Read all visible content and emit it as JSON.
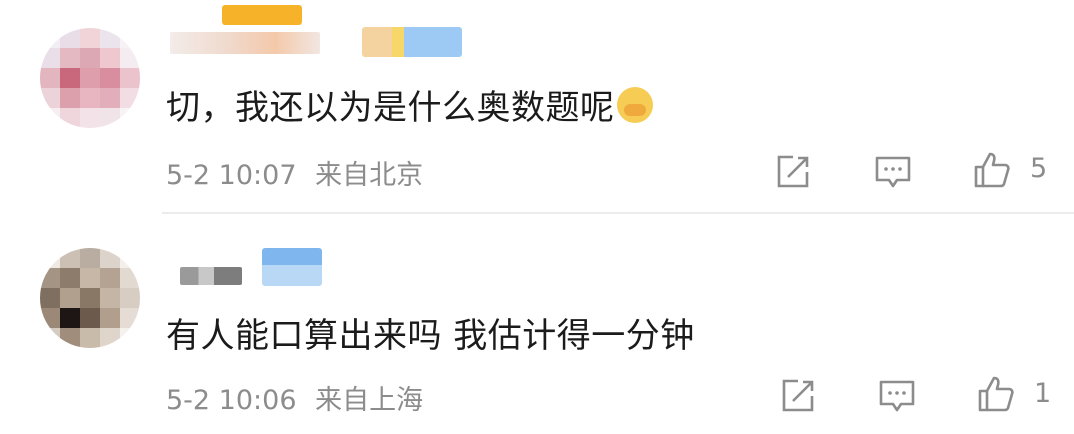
{
  "comments": [
    {
      "text": "切，我还以为是什么奥数题呢",
      "emoji_icon": "angry-face-emoji",
      "time": "5-2 10:07",
      "location": "来自北京",
      "likes": "5"
    },
    {
      "text": "有人能口算出来吗 我估计得一分钟",
      "time": "5-2 10:06",
      "location": "来自上海",
      "likes": "1"
    }
  ],
  "icons": {
    "share": "share-icon",
    "reply": "comment-icon",
    "like": "thumbs-up-icon"
  },
  "colors": {
    "text": "#1b1b1b",
    "meta": "#8c8c8c",
    "divider": "#ececec",
    "badge_orange": "#f6b32a",
    "badge_blue": "#8ec3f2"
  }
}
